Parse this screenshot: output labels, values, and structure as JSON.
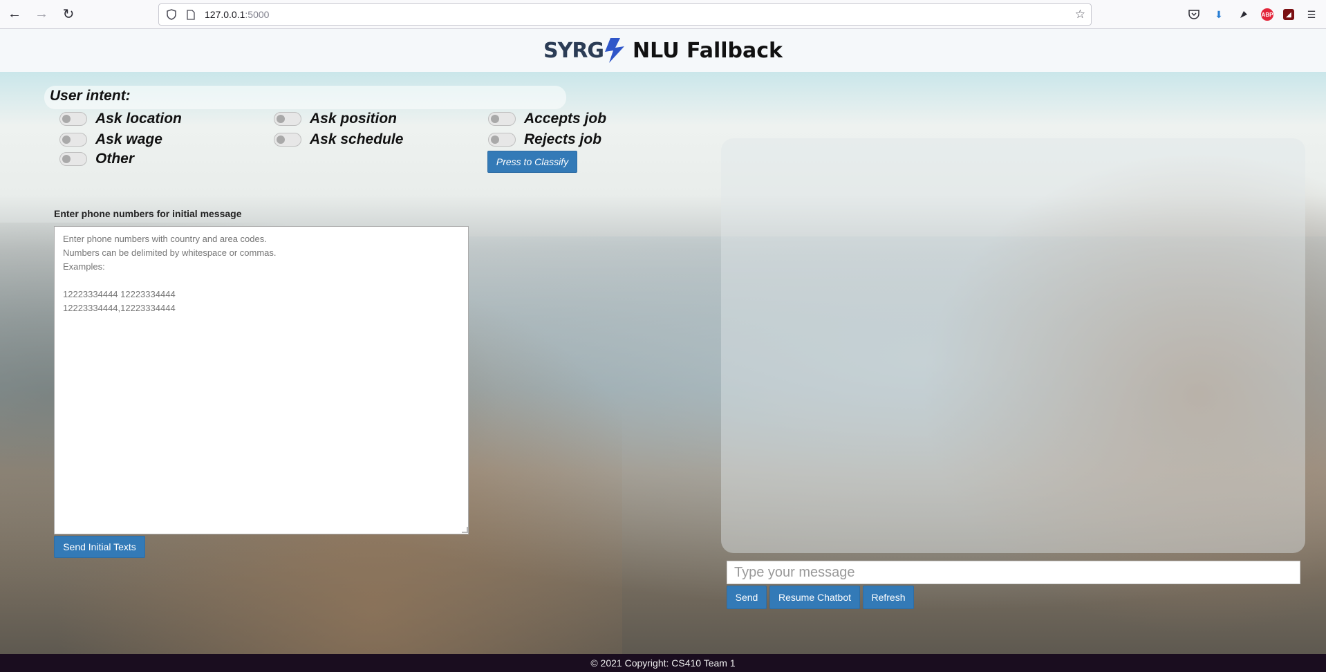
{
  "browser": {
    "url_host": "127.0.0.1",
    "url_port": ":5000",
    "icons": [
      "back-icon",
      "forward-icon",
      "reload-icon",
      "shield-icon",
      "page-icon",
      "bookmark-star-icon",
      "pocket-icon",
      "download-icon",
      "extension-icon",
      "adblock-icon",
      "extension-red-icon",
      "menu-icon"
    ],
    "abp_label": "ABP"
  },
  "header": {
    "logo_text": "SYRG",
    "title": "NLU Fallback"
  },
  "intent": {
    "label": "User intent:",
    "options": [
      {
        "label": "Ask location"
      },
      {
        "label": "Ask position"
      },
      {
        "label": "Accepts job"
      },
      {
        "label": "Ask wage"
      },
      {
        "label": "Ask schedule"
      },
      {
        "label": "Rejects job"
      },
      {
        "label": "Other"
      }
    ],
    "classify_button": "Press to Classify"
  },
  "phone": {
    "label": "Enter phone numbers for initial message",
    "placeholder": "Enter phone numbers with country and area codes.\nNumbers can be delimited by whitespace or commas.\nExamples:\n\n12223334444 12223334444\n12223334444,12223334444",
    "send_button": "Send Initial Texts"
  },
  "chat": {
    "input_placeholder": "Type your message",
    "send_button": "Send",
    "resume_button": "Resume Chatbot",
    "refresh_button": "Refresh"
  },
  "footer": {
    "text": "© 2021 Copyright: CS410 Team 1"
  },
  "colors": {
    "button_blue": "#337ab7",
    "footer_bg": "#1a0d1f",
    "header_bg": "#f5f8fa",
    "logo_navy": "#2b3c55",
    "bolt_blue": "#2f56c9"
  }
}
